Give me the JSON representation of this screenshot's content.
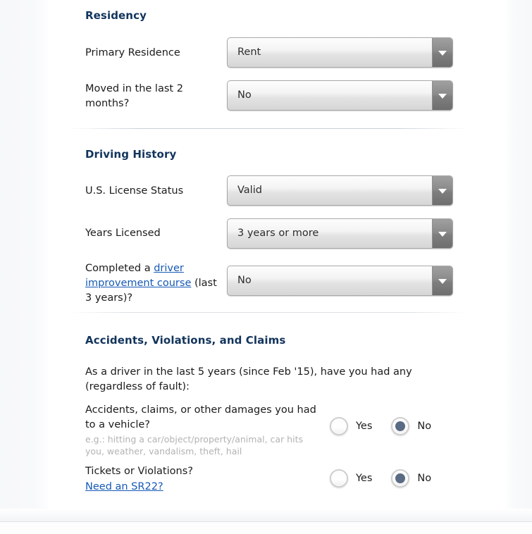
{
  "sections": [
    {
      "id": "residency",
      "title": "Residency",
      "fields": [
        {
          "label": "Primary Residence",
          "value": "Rent"
        },
        {
          "label": "Moved in the last 2 months?",
          "value": "No"
        }
      ]
    },
    {
      "id": "driving_history",
      "title": "Driving History",
      "fields": [
        {
          "label": "U.S. License Status",
          "value": "Valid"
        },
        {
          "label": "Years Licensed",
          "value": "3 years or more"
        },
        {
          "label_prefix": "Completed a ",
          "link_text": "driver improvement course",
          "label_suffix": " (last 3 years)?",
          "value": "No"
        }
      ]
    },
    {
      "id": "accidents",
      "title": "Accidents, Violations, and Claims",
      "intro": "As a driver in the last 5 years (since Feb '15), have you had any (regardless of fault):",
      "questions": [
        {
          "text": "Accidents, claims, or other damages you had to a vehicle?",
          "hint": "e.g.: hitting a car/object/property/animal, car hits you, weather, vandalism, theft, hail",
          "link": "",
          "options": [
            {
              "label": "Yes",
              "selected": false
            },
            {
              "label": "No",
              "selected": true
            }
          ]
        },
        {
          "text": "Tickets or Violations?",
          "hint": "",
          "link": "Need an SR22?",
          "options": [
            {
              "label": "Yes",
              "selected": false
            },
            {
              "label": "No",
              "selected": true
            }
          ]
        }
      ]
    }
  ],
  "colors": {
    "heading": "#12345c",
    "link": "#1559b5",
    "radio_selected": "#5a6b84",
    "hint": "#b3b3b3"
  },
  "icons": {
    "dropdown_arrow": "chevron-down-icon"
  }
}
